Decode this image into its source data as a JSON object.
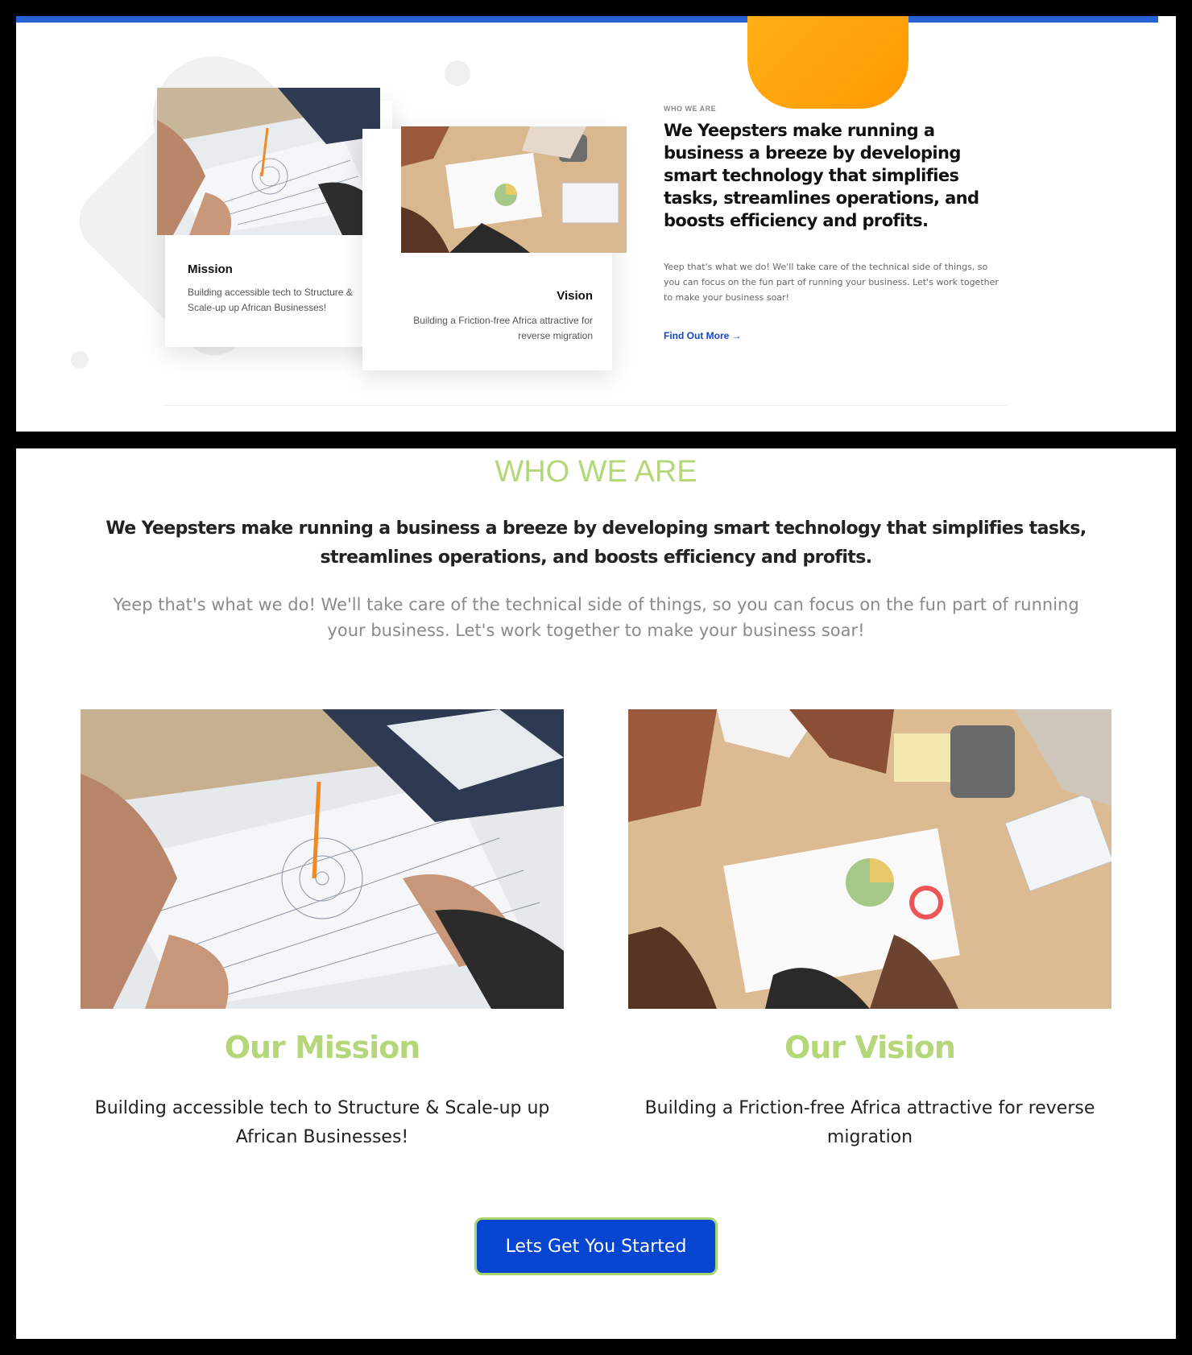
{
  "top_section": {
    "mission_card": {
      "title": "Mission",
      "text": "Building accessible tech to Structure & Scale-up up African Businesses!"
    },
    "vision_card": {
      "title": "Vision",
      "text": "Building a Friction-free Africa attractive for reverse migration"
    },
    "eyebrow": "WHO WE ARE",
    "headline": "We Yeepsters make running a business a breeze by developing smart technology that simplifies tasks, streamlines operations, and boosts efficiency and profits.",
    "lede": "Yeep that's what we do! We'll take care of the technical side of things, so you can focus on the fun part of running your business. Let's work together to make your business soar!",
    "find_more": "Find Out More"
  },
  "bottom_section": {
    "title": "WHO WE ARE",
    "headline": "We Yeepsters make running a business a breeze by developing smart technology that simplifies tasks, streamlines operations, and boosts efficiency and profits.",
    "lede": "Yeep that's what we do! We'll take care of the technical side of things, so you can focus on the fun part of running your business. Let's work together to make your business soar!",
    "mission": {
      "title": "Our Mission",
      "text": "Building accessible tech to Structure & Scale-up up African Businesses!"
    },
    "vision": {
      "title": "Our Vision",
      "text": "Building a Friction-free Africa attractive for reverse migration"
    },
    "cta": "Lets Get You Started"
  },
  "colors": {
    "accent_blue": "#0645d0",
    "accent_green": "#b5d77a",
    "orange": "#ff9900"
  }
}
